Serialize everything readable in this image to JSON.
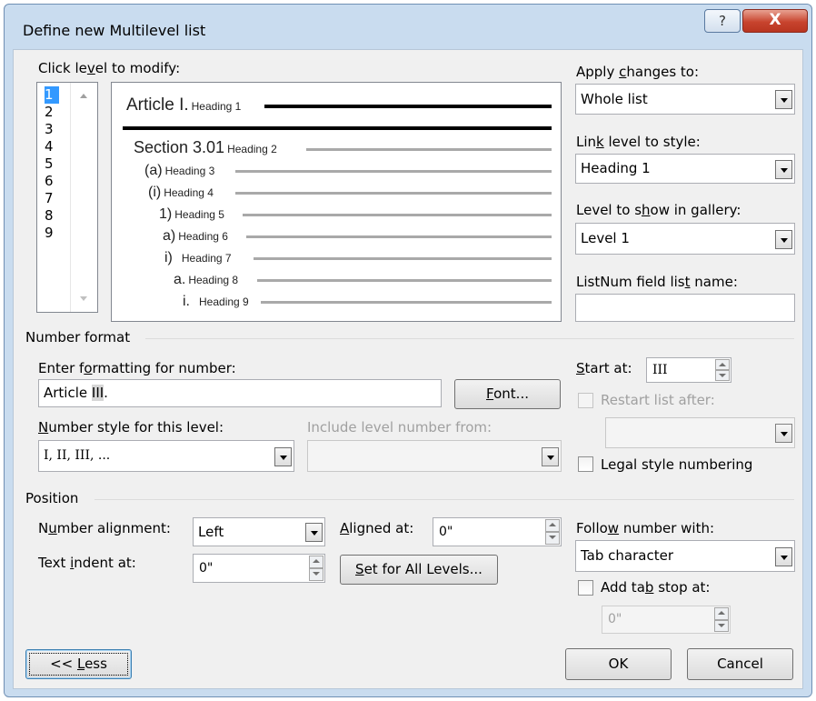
{
  "window": {
    "title": "Define new Multilevel list",
    "help_label": "?",
    "close_label": "X"
  },
  "level_list": {
    "label_pre": "Click le",
    "label_ul": "v",
    "label_post": "el to modify:",
    "items": [
      "1",
      "2",
      "3",
      "4",
      "5",
      "6",
      "7",
      "8",
      "9"
    ],
    "selected": "1"
  },
  "preview": {
    "rows": [
      {
        "number": "Article I.",
        "heading": "Heading 1"
      },
      {
        "number": "Section 3.01",
        "heading": "Heading 2"
      },
      {
        "number": "(a)",
        "heading": "Heading 3"
      },
      {
        "number": "(i)",
        "heading": "Heading 4"
      },
      {
        "number": "1)",
        "heading": "Heading 5"
      },
      {
        "number": "a)",
        "heading": "Heading 6"
      },
      {
        "number": "i)",
        "heading": "Heading 7"
      },
      {
        "number": "a.",
        "heading": "Heading 8"
      },
      {
        "number": "i.",
        "heading": "Heading 9"
      }
    ]
  },
  "apply_changes": {
    "label_pre": "Apply ",
    "label_ul": "c",
    "label_post": "hanges to:",
    "value": "Whole list"
  },
  "link_level": {
    "label_pre": "Lin",
    "label_ul": "k",
    "label_post": " level to style:",
    "value": "Heading 1"
  },
  "gallery_level": {
    "label_pre": "Level to s",
    "label_ul": "h",
    "label_post": "ow in gallery:",
    "value": "Level 1"
  },
  "listnum": {
    "label_pre": "ListNum field lis",
    "label_ul": "t",
    "label_post": " name:",
    "value": ""
  },
  "number_format": {
    "section_label": "Number format",
    "enter_label_pre": "Enter f",
    "enter_label_ul": "o",
    "enter_label_post": "rmatting for number:",
    "format_prefix": "Article ",
    "format_token": "III",
    "format_suffix": ".",
    "font_button_ul": "F",
    "font_button_post": "ont...",
    "style_label_ul": "N",
    "style_label_post": "umber style for this level:",
    "style_value": "I, II, III, ...",
    "include_label": "Include level number from:",
    "include_value": ""
  },
  "start_at": {
    "label_ul": "S",
    "label_post": "tart at:",
    "value": "III"
  },
  "restart_list": {
    "label": "Restart list after:",
    "value": "",
    "checked": false
  },
  "legal_style": {
    "label": "Legal style numbering",
    "checked": false
  },
  "position": {
    "section_label": "Position",
    "alignment_label_pre": "N",
    "alignment_label_ul": "u",
    "alignment_label_post": "mber alignment:",
    "alignment_value": "Left",
    "aligned_at_label_ul": "A",
    "aligned_at_label_post": "ligned at:",
    "aligned_at_value": "0\"",
    "indent_label_pre": "Text ",
    "indent_label_ul": "i",
    "indent_label_post": "ndent at:",
    "indent_value": "0\"",
    "set_all_ul": "S",
    "set_all_post": "et for All Levels..."
  },
  "follow_number": {
    "label_pre": "Follo",
    "label_ul": "w",
    "label_post": " number with:",
    "value": "Tab character"
  },
  "tab_stop": {
    "label_pre": "Add ta",
    "label_ul": "b",
    "label_post": " stop at:",
    "value": "0\"",
    "checked": false
  },
  "buttons": {
    "less_pre": "<< ",
    "less_ul": "L",
    "less_post": "ess",
    "ok": "OK",
    "cancel": "Cancel"
  },
  "colors": {
    "selection": "#3399ff",
    "dialog_bg": "#f0f0f0",
    "frame": "#c9dcef",
    "close_red": "#c8442e"
  }
}
